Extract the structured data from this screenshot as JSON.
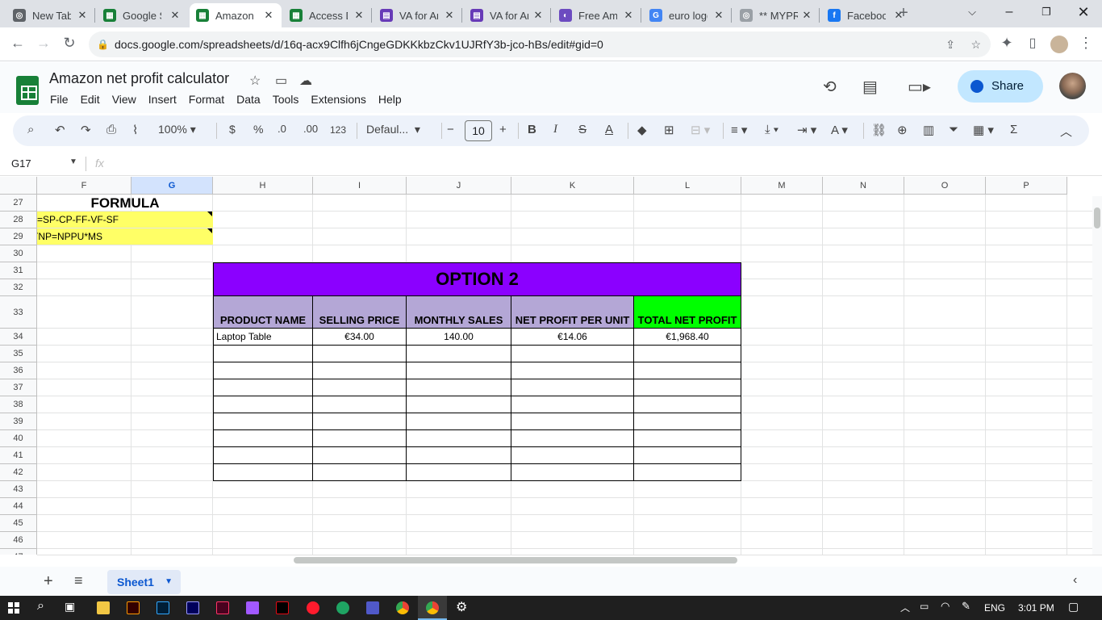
{
  "browser": {
    "tabs": [
      {
        "title": "New Tab",
        "color": "#5f6368",
        "glyph": "◎"
      },
      {
        "title": "Google Sheets",
        "color": "#188038",
        "glyph": "▦"
      },
      {
        "title": "Amazon net profit calculator",
        "color": "#188038",
        "glyph": "▦"
      },
      {
        "title": "Access Denied",
        "color": "#188038",
        "glyph": "▦"
      },
      {
        "title": "VA for Amazon",
        "color": "#673ab7",
        "glyph": "▤"
      },
      {
        "title": "VA for Amazon",
        "color": "#673ab7",
        "glyph": "▤"
      },
      {
        "title": "Free Amazon",
        "color": "#6c4bc0",
        "glyph": "◐"
      },
      {
        "title": "euro logo",
        "color": "#4285f4",
        "glyph": "G"
      },
      {
        "title": "** MYPROFIT",
        "color": "#9aa0a6",
        "glyph": "◎"
      },
      {
        "title": "Facebook",
        "color": "#1877f2",
        "glyph": "f"
      }
    ],
    "url": "docs.google.com/spreadsheets/d/16q-acx9Clfh6jCngeGDKKkbzCkv1UJRfY3b-jco-hBs/edit#gid=0"
  },
  "doc": {
    "title": "Amazon net profit calculator",
    "menus": [
      "File",
      "Edit",
      "View",
      "Insert",
      "Format",
      "Data",
      "Tools",
      "Extensions",
      "Help"
    ],
    "share_label": "Share"
  },
  "toolbar": {
    "zoom": "100%",
    "currency": "$",
    "percent": "%",
    "dec_dec": ".0",
    "inc_dec": ".00",
    "numfmt": "123",
    "font": "Defaul...",
    "font_size": "10"
  },
  "formula_bar": {
    "name_box": "G17",
    "fx": "fx"
  },
  "grid": {
    "columns": [
      {
        "id": "F",
        "w": 117
      },
      {
        "id": "G",
        "w": 101,
        "selected": true
      },
      {
        "id": "H",
        "w": 124
      },
      {
        "id": "I",
        "w": 116
      },
      {
        "id": "J",
        "w": 130
      },
      {
        "id": "K",
        "w": 152
      },
      {
        "id": "L",
        "w": 133
      },
      {
        "id": "M",
        "w": 101
      },
      {
        "id": "N",
        "w": 101
      },
      {
        "id": "O",
        "w": 101
      },
      {
        "id": "P",
        "w": 101
      }
    ],
    "rows": [
      "27",
      "28",
      "29",
      "30",
      "31",
      "32",
      "33",
      "34",
      "35",
      "36",
      "37",
      "38",
      "39",
      "40",
      "41",
      "42",
      "43",
      "44",
      "45",
      "46",
      "47"
    ],
    "formula_heading": "FORMULA",
    "formula_1": "J=SP-CP-FF-VF-SF",
    "formula_2": "TNP=NPPU*MS",
    "option_title": "OPTION 2",
    "headers": [
      "PRODUCT NAME",
      "SELLING PRICE",
      "MONTHLY SALES",
      "NET PROFIT PER UNIT",
      "TOTAL NET PROFIT"
    ],
    "row1": [
      "Laptop Table",
      "€34.00",
      "140.00",
      "€14.06",
      "€1,968.40"
    ],
    "colors": {
      "purple": "#8b00ff",
      "header_lilac": "#b4a7d6",
      "header_green": "#00ff00",
      "formula_yellow": "#ffff66"
    }
  },
  "sheet": {
    "name": "Sheet1"
  },
  "taskbar": {
    "language": "ENG",
    "time": "3:01 PM"
  }
}
